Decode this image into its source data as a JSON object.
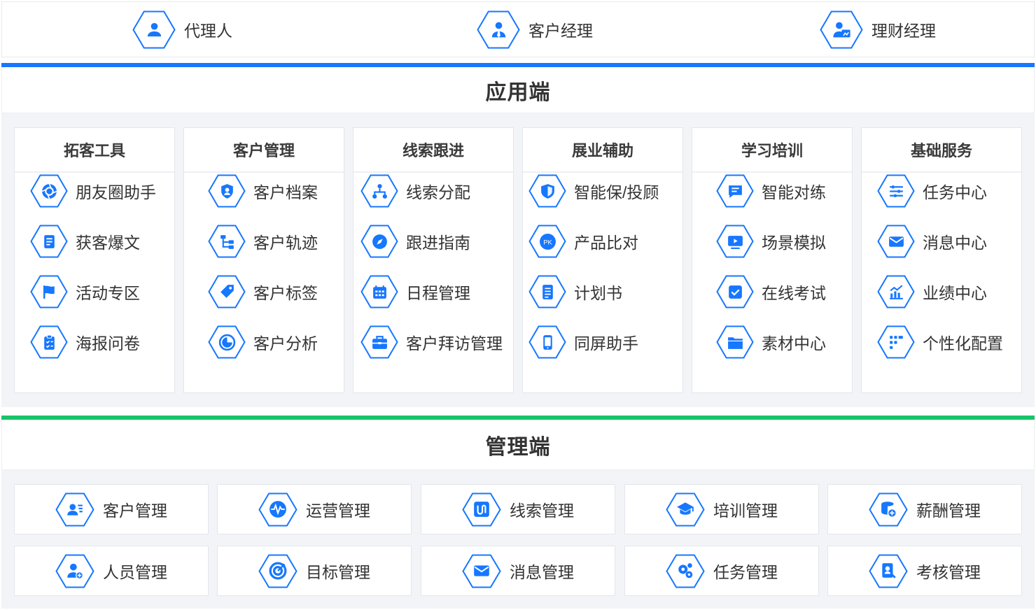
{
  "roles": [
    {
      "label": "代理人",
      "icon": "person-icon"
    },
    {
      "label": "客户经理",
      "icon": "manager-icon"
    },
    {
      "label": "理财经理",
      "icon": "finance-manager-icon"
    }
  ],
  "app_section": {
    "title": "应用端",
    "accent": "#1677ff",
    "columns": [
      {
        "title": "拓客工具",
        "items": [
          {
            "label": "朋友圈助手",
            "icon": "aperture-icon"
          },
          {
            "label": "获客爆文",
            "icon": "document-icon"
          },
          {
            "label": "活动专区",
            "icon": "flag-icon"
          },
          {
            "label": "海报问卷",
            "icon": "clipboard-icon"
          }
        ]
      },
      {
        "title": "客户管理",
        "items": [
          {
            "label": "客户档案",
            "icon": "profile-shield-icon"
          },
          {
            "label": "客户轨迹",
            "icon": "tree-icon"
          },
          {
            "label": "客户标签",
            "icon": "tag-icon"
          },
          {
            "label": "客户分析",
            "icon": "pie-icon"
          }
        ]
      },
      {
        "title": "线索跟进",
        "items": [
          {
            "label": "线索分配",
            "icon": "hierarchy-icon"
          },
          {
            "label": "跟进指南",
            "icon": "compass-icon"
          },
          {
            "label": "日程管理",
            "icon": "calendar-icon"
          },
          {
            "label": "客户拜访管理",
            "icon": "briefcase-icon"
          }
        ]
      },
      {
        "title": "展业辅助",
        "items": [
          {
            "label": "智能保/投顾",
            "icon": "shield-icon"
          },
          {
            "label": "产品比对",
            "icon": "pk-icon"
          },
          {
            "label": "计划书",
            "icon": "list-doc-icon"
          },
          {
            "label": "同屏助手",
            "icon": "phone-icon"
          }
        ]
      },
      {
        "title": "学习培训",
        "items": [
          {
            "label": "智能对练",
            "icon": "chat-icon"
          },
          {
            "label": "场景模拟",
            "icon": "video-icon"
          },
          {
            "label": "在线考试",
            "icon": "exam-check-icon"
          },
          {
            "label": "素材中心",
            "icon": "folder-icon"
          }
        ]
      },
      {
        "title": "基础服务",
        "items": [
          {
            "label": "任务中心",
            "icon": "sliders-icon"
          },
          {
            "label": "消息中心",
            "icon": "mail-icon"
          },
          {
            "label": "业绩中心",
            "icon": "chart-icon"
          },
          {
            "label": "个性化配置",
            "icon": "grid-dots-icon"
          }
        ]
      }
    ]
  },
  "mgmt_section": {
    "title": "管理端",
    "accent": "#17c56a",
    "items": [
      {
        "label": "客户管理",
        "icon": "contacts-icon"
      },
      {
        "label": "运营管理",
        "icon": "pulse-icon"
      },
      {
        "label": "线索管理",
        "icon": "clue-icon"
      },
      {
        "label": "培训管理",
        "icon": "graduation-icon"
      },
      {
        "label": "薪酬管理",
        "icon": "coins-icon"
      },
      {
        "label": "人员管理",
        "icon": "user-add-icon"
      },
      {
        "label": "目标管理",
        "icon": "target-icon"
      },
      {
        "label": "消息管理",
        "icon": "mail-icon"
      },
      {
        "label": "任务管理",
        "icon": "gears-icon"
      },
      {
        "label": "考核管理",
        "icon": "assessment-icon"
      }
    ]
  }
}
